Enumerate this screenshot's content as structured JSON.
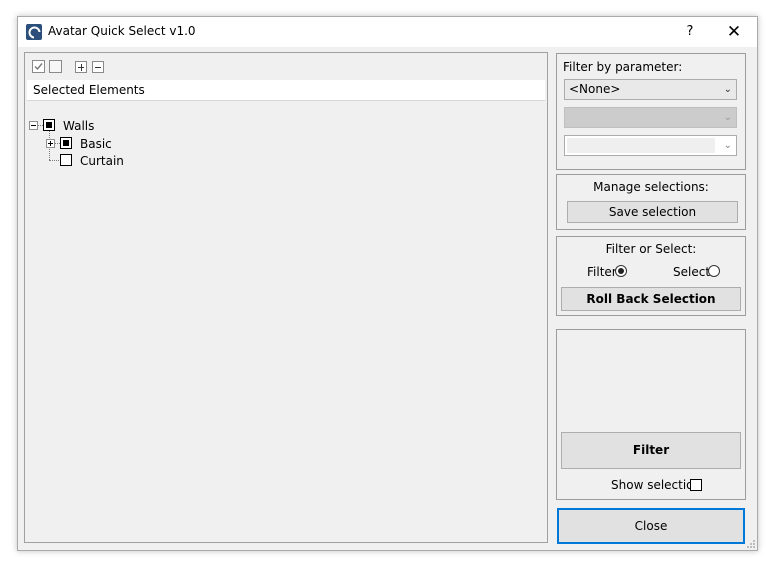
{
  "window": {
    "title": "Avatar Quick Select v1.0",
    "help_label": "?",
    "close_label": "✕"
  },
  "tree": {
    "header": "Selected Elements",
    "nodes": [
      {
        "label": "Walls",
        "state": "partial"
      },
      {
        "label": "Basic",
        "state": "partial"
      },
      {
        "label": "Curtain",
        "state": "unchecked"
      }
    ]
  },
  "filter_param": {
    "label": "Filter by parameter:",
    "combo1_value": "<None>"
  },
  "manage": {
    "label": "Manage selections:",
    "save_button": "Save selection"
  },
  "filter_select": {
    "label": "Filter or Select:",
    "filter_option": "Filter",
    "select_option": "Select",
    "selected": "Filter",
    "rollback_button": "Roll Back Selection"
  },
  "actions": {
    "filter_button": "Filter",
    "show_selection_label": "Show selection",
    "close_button": "Close"
  },
  "colors": {
    "window_bg": "#f0f0f0",
    "focus_border": "#0078d7"
  }
}
